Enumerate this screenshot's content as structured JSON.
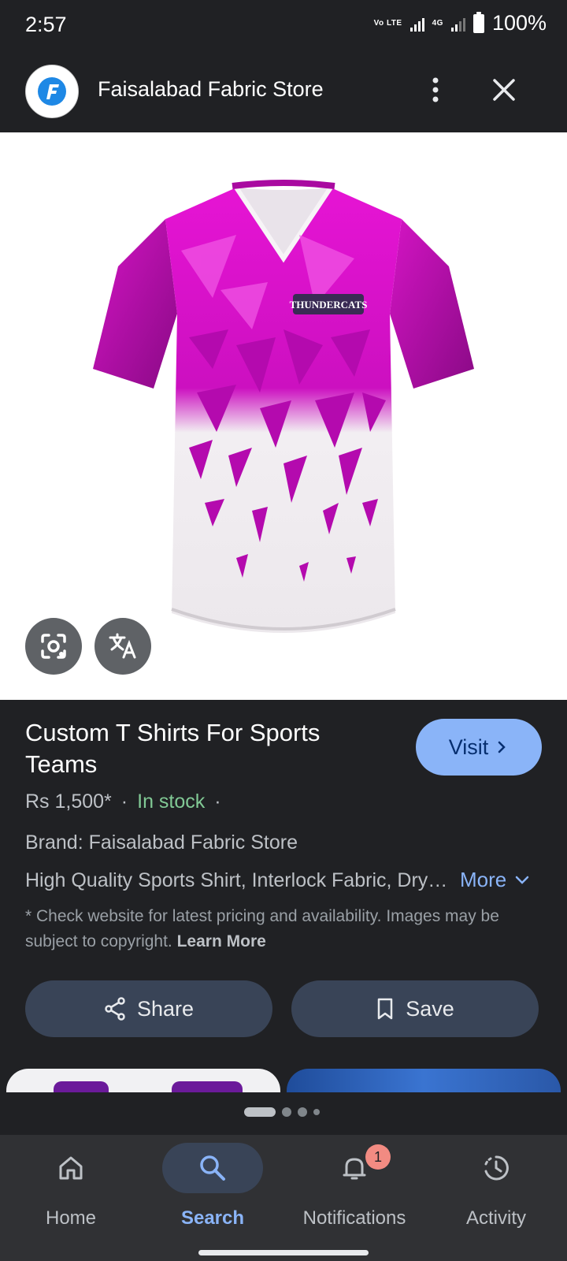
{
  "status_bar": {
    "time": "2:57",
    "network_top": "Vo LTE",
    "network_type": "4G",
    "battery": "100%"
  },
  "header": {
    "store_name": "Faisalabad Fabric Store",
    "logo_letter": "F"
  },
  "product": {
    "shirt_badge": "THUNDERCATS",
    "title": "Custom T Shirts For Sports Teams",
    "visit_label": "Visit",
    "price": "Rs 1,500*",
    "separator": "·",
    "stock": "In stock",
    "brand": "Brand: Faisalabad Fabric Store",
    "description": "High Quality Sports Shirt, Interlock Fabric, Dry Fit",
    "more_label": "More",
    "disclaimer": "* Check website for latest pricing and availability. Images may be subject to copyright.",
    "learn_more": "Learn More"
  },
  "actions": {
    "share_label": "Share",
    "save_label": "Save"
  },
  "bottom_nav": [
    {
      "label": "Home",
      "icon": "home-icon"
    },
    {
      "label": "Search",
      "icon": "search-icon",
      "active": true
    },
    {
      "label": "Notifications",
      "icon": "bell-icon",
      "badge": "1"
    },
    {
      "label": "Activity",
      "icon": "history-icon"
    }
  ],
  "colors": {
    "accent": "#8ab4f8",
    "in_stock": "#81c995",
    "shirt_magenta": "#e011c8"
  }
}
